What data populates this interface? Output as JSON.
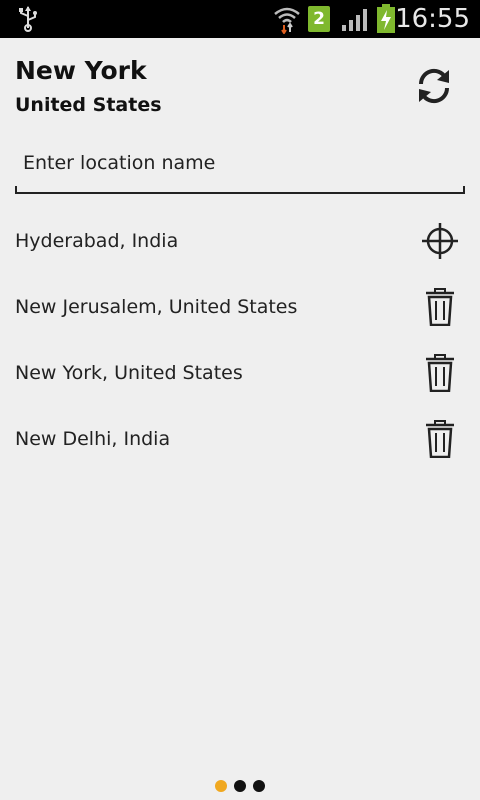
{
  "statusbar": {
    "time": "16:55",
    "sim_slot": "2",
    "icons": [
      "usb-icon",
      "wifi-icon",
      "sim-icon",
      "signal-icon",
      "battery-charging-icon"
    ],
    "sim_color": "#7fb82e"
  },
  "header": {
    "city": "New York",
    "country": "United States",
    "refresh_icon": "refresh-icon"
  },
  "search": {
    "placeholder": "Enter location name",
    "value": ""
  },
  "locations": [
    {
      "label": "Hyderabad, India",
      "action_icon": "locate-crosshair-icon"
    },
    {
      "label": "New Jerusalem, United States",
      "action_icon": "trash-icon"
    },
    {
      "label": "New York, United States",
      "action_icon": "trash-icon"
    },
    {
      "label": "New Delhi, India",
      "action_icon": "trash-icon"
    }
  ],
  "pager": {
    "page_count": 3,
    "active_index": 0,
    "active_color": "#f0a820"
  }
}
